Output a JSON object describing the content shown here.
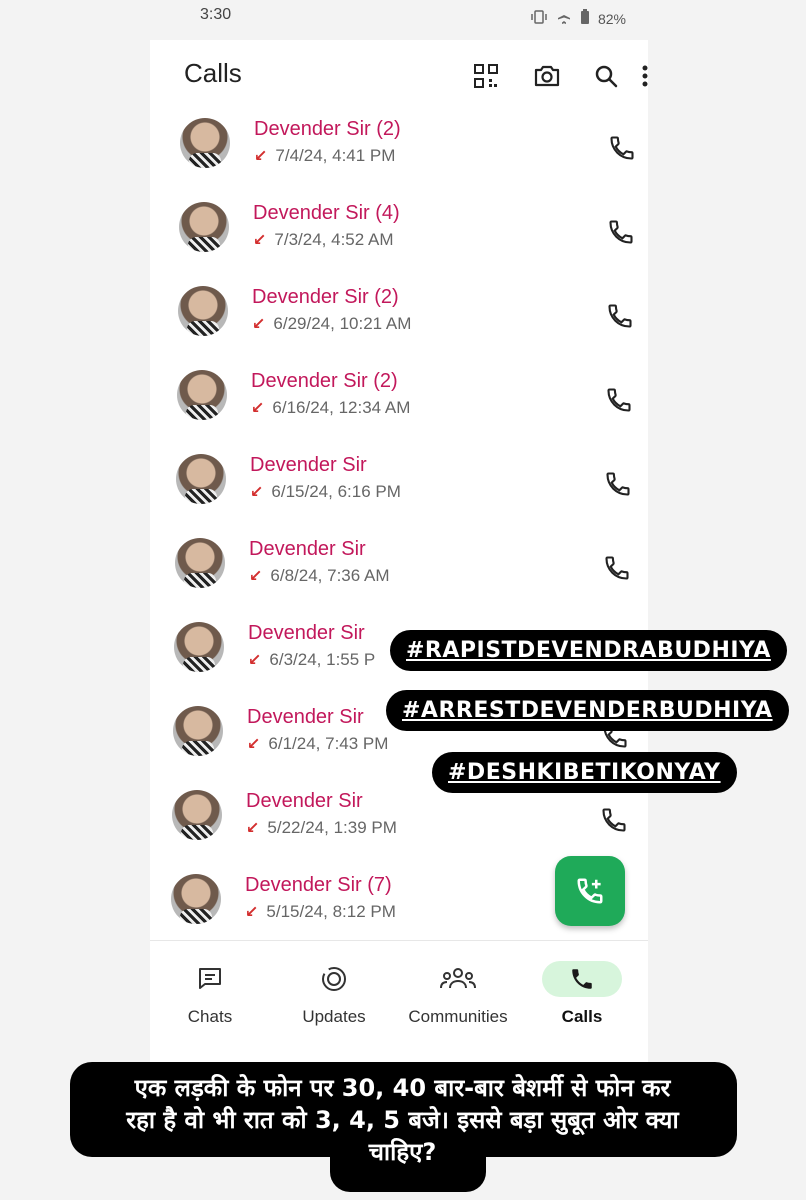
{
  "status": {
    "time": "3:30",
    "battery": "82%"
  },
  "header": {
    "title": "Calls"
  },
  "calls": [
    {
      "name": "Devender Sir (2)",
      "time": "7/4/24, 4:41 PM"
    },
    {
      "name": "Devender Sir (4)",
      "time": "7/3/24, 4:52 AM"
    },
    {
      "name": "Devender Sir (2)",
      "time": "6/29/24, 10:21 AM"
    },
    {
      "name": "Devender Sir (2)",
      "time": "6/16/24, 12:34 AM"
    },
    {
      "name": "Devender Sir",
      "time": "6/15/24, 6:16 PM"
    },
    {
      "name": "Devender Sir",
      "time": "6/8/24, 7:36 AM"
    },
    {
      "name": "Devender Sir",
      "time": "6/3/24, 1:55 P"
    },
    {
      "name": "Devender Sir",
      "time": "6/1/24, 7:43 PM"
    },
    {
      "name": "Devender Sir",
      "time": "5/22/24, 1:39 PM"
    },
    {
      "name": "Devender Sir (7)",
      "time": "5/15/24, 8:12 PM"
    }
  ],
  "nav": {
    "chats": "Chats",
    "updates": "Updates",
    "communities": "Communities",
    "calls": "Calls"
  },
  "overlay": {
    "hashtags": [
      "#RAPISTDEVENDRABUDHIYA",
      "#ARRESTDEVENDERBUDHIYA",
      "#DESHKIBETIKONYAY"
    ],
    "caption_line1": "एक लड़की के फोन पर 30, 40 बार-बार बेशर्मी से फोन कर",
    "caption_line2": "रहा है वो भी रात को 3, 4, 5 बजे। इससे बड़ा सुबूत ओर क्या",
    "caption_line3": "चाहिए?"
  },
  "colors": {
    "name": "#c2185b",
    "accent": "#1faa59",
    "missed_arrow": "#d32f2f"
  }
}
